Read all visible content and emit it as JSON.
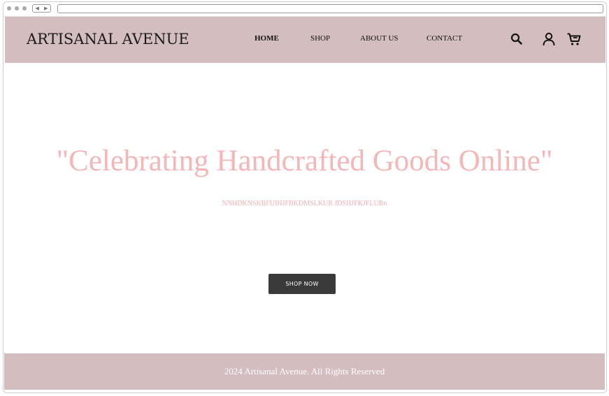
{
  "header": {
    "brand": "ARTISANAL AVENUE",
    "nav": [
      {
        "label": "HOME",
        "active": true
      },
      {
        "label": "SHOP",
        "active": false
      },
      {
        "label": "ABOUT US",
        "active": false
      },
      {
        "label": "CONTACT",
        "active": false
      }
    ],
    "icons": [
      "search-icon",
      "user-icon",
      "cart-icon"
    ]
  },
  "hero": {
    "title": "\"Celebrating Handcrafted Goods Online\"",
    "subtitle": "NNHDKNSKBFUIHJFBKDMSLKUR JDSHJFKJFLURn",
    "button_label": "SHOP NOW"
  },
  "footer": {
    "text": "2024 Artisanal Avenue. All Rights Reserved"
  },
  "colors": {
    "header_bg": "#d3bdbe",
    "hero_text": "#f5b6b8",
    "button_bg": "#3a3a3a"
  }
}
